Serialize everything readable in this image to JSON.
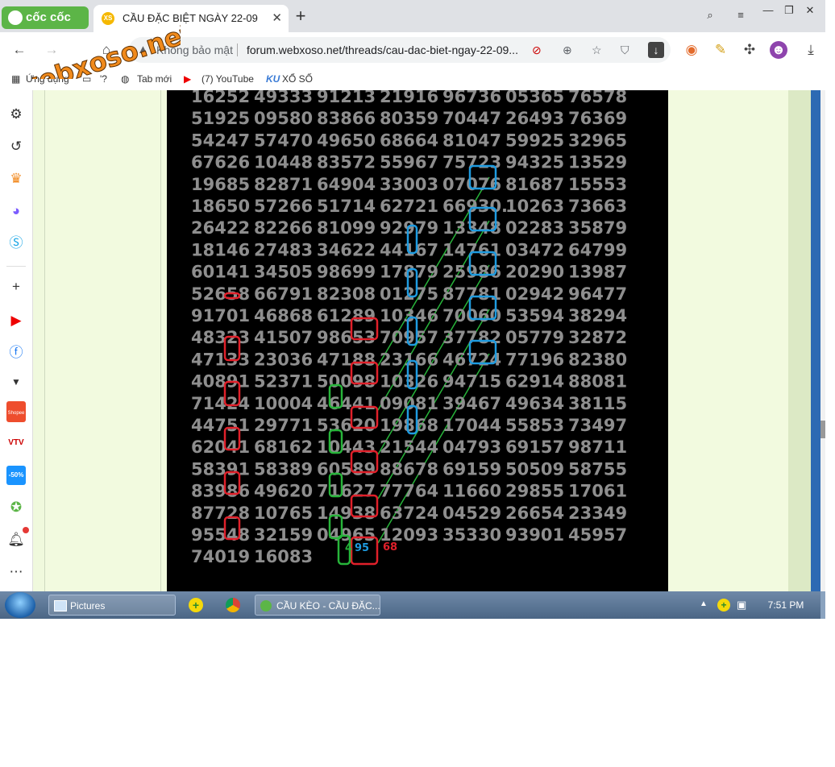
{
  "browser": {
    "brand": "cốc cốc",
    "tab": {
      "favicon_text": "XS",
      "title": "CẦU ĐẶC BIỆT NGÀY 22-09"
    },
    "address": {
      "security_label": "Không bảo mật",
      "url": "forum.webxoso.net/threads/cau-dac-biet-ngay-22-09..."
    },
    "bookmarks": [
      "Ứng dụng",
      "'?",
      "Tab mới",
      "(7) YouTube",
      "XỔ SỐ"
    ]
  },
  "watermark": {
    "text": "webxoso.net"
  },
  "sidebar": {
    "icons": [
      "settings-icon",
      "history-icon",
      "crown-icon",
      "messenger-icon",
      "skype-icon",
      "add-icon",
      "youtube-icon",
      "facebook-icon",
      "chevron-down-icon",
      "shopee-icon",
      "vtv-go-icon",
      "tiki-icon",
      "extension-icon",
      "bell-icon",
      "more-icon"
    ],
    "shopee_label": "Shopee",
    "tiki_label": "-50%"
  },
  "board": {
    "rows": [
      [
        "16252",
        "49333",
        "91213",
        "21916",
        "96736",
        "05365",
        "76578"
      ],
      [
        "51925",
        "09580",
        "83866",
        "80359",
        "70447",
        "26493",
        "76369"
      ],
      [
        "54247",
        "57470",
        "49650",
        "68664",
        "81047",
        "59925",
        "32965"
      ],
      [
        "67626",
        "10448",
        "83572",
        "55967",
        "75723",
        "94325",
        "13529"
      ],
      [
        "19685",
        "82871",
        "64904",
        "33003",
        "07076",
        "81687",
        "15553"
      ],
      [
        "18650",
        "57266",
        "51714",
        "62721",
        "66930.",
        "10263",
        "73663"
      ],
      [
        "26422",
        "82266",
        "81099",
        "92979",
        "13348",
        "02283",
        "35879"
      ],
      [
        "18146",
        "27483",
        "34622",
        "44167",
        "14761",
        "03472",
        "64799"
      ],
      [
        "60141",
        "34505",
        "98699",
        "17879",
        "25986",
        "20290",
        "13987"
      ],
      [
        "52658",
        "66791",
        "82308",
        "01275",
        "87781",
        "02942",
        "96477"
      ],
      [
        "91701",
        "46868",
        "61289",
        "10346",
        "70060",
        "53594",
        "38294"
      ],
      [
        "48323",
        "41507",
        "98653",
        "70957",
        "37782",
        "05779",
        "32872"
      ],
      [
        "47133",
        "23036",
        "47188",
        "23166",
        "46724",
        "77196",
        "82380"
      ],
      [
        "40891",
        "52371",
        "50098",
        "10326",
        "94715",
        "62914",
        "88081"
      ],
      [
        "71424",
        "10004",
        "46441",
        "09081",
        "39467",
        "49634",
        "38115"
      ],
      [
        "44751",
        "29771",
        "53620",
        "19868",
        "17044",
        "55853",
        "73497"
      ],
      [
        "62041",
        "68162",
        "10443",
        "21544",
        "04793",
        "69157",
        "98711"
      ],
      [
        "58391",
        "58389",
        "60589",
        "88678",
        "69159",
        "50509",
        "58755"
      ],
      [
        "83986",
        "49620",
        "71627",
        "77764",
        "11660",
        "29855",
        "17061"
      ],
      [
        "87728",
        "10765",
        "14938",
        "63724",
        "04529",
        "26654",
        "23349"
      ],
      [
        "95548",
        "32159",
        "04965",
        "12093",
        "35330",
        "93901",
        "45957"
      ],
      [
        "74019",
        "16083"
      ]
    ],
    "prediction": {
      "digit": "4",
      "pair": "95",
      "extra": "68"
    },
    "colors": {
      "red": "#e0202a",
      "blue": "#1e9be0",
      "green": "#27b43a",
      "digits": "#8e8e8e"
    }
  },
  "taskbar": {
    "items": [
      {
        "label": "Pictures"
      },
      {
        "label": "CẦU KÈO - CẦU ĐẶC..."
      }
    ],
    "clock": "7:51 PM"
  }
}
